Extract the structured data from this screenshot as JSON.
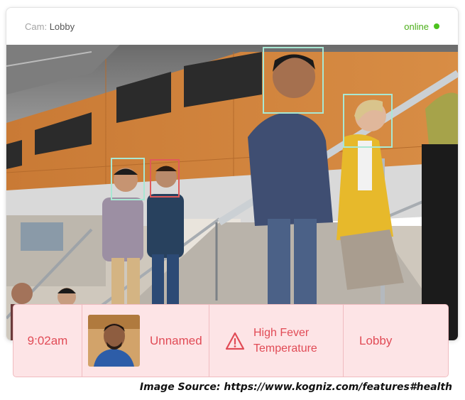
{
  "header": {
    "cam_prefix": "Cam:",
    "cam_name": "Lobby",
    "status": "online",
    "status_color": "#4cc21e"
  },
  "detections": [
    {
      "color": "#a8e8d3"
    },
    {
      "color": "#e05a5a"
    },
    {
      "color": "#a8e8d3"
    },
    {
      "color": "#a8e8d3"
    }
  ],
  "alert": {
    "time": "9:02am",
    "person": "Unnamed",
    "alert_line1": "High Fever",
    "alert_line2": "Temperature",
    "location": "Lobby",
    "accent_color": "#e14b56",
    "icon": "warning-triangle-icon"
  },
  "source": "Image Source: https://www.kogniz.com/features#health"
}
